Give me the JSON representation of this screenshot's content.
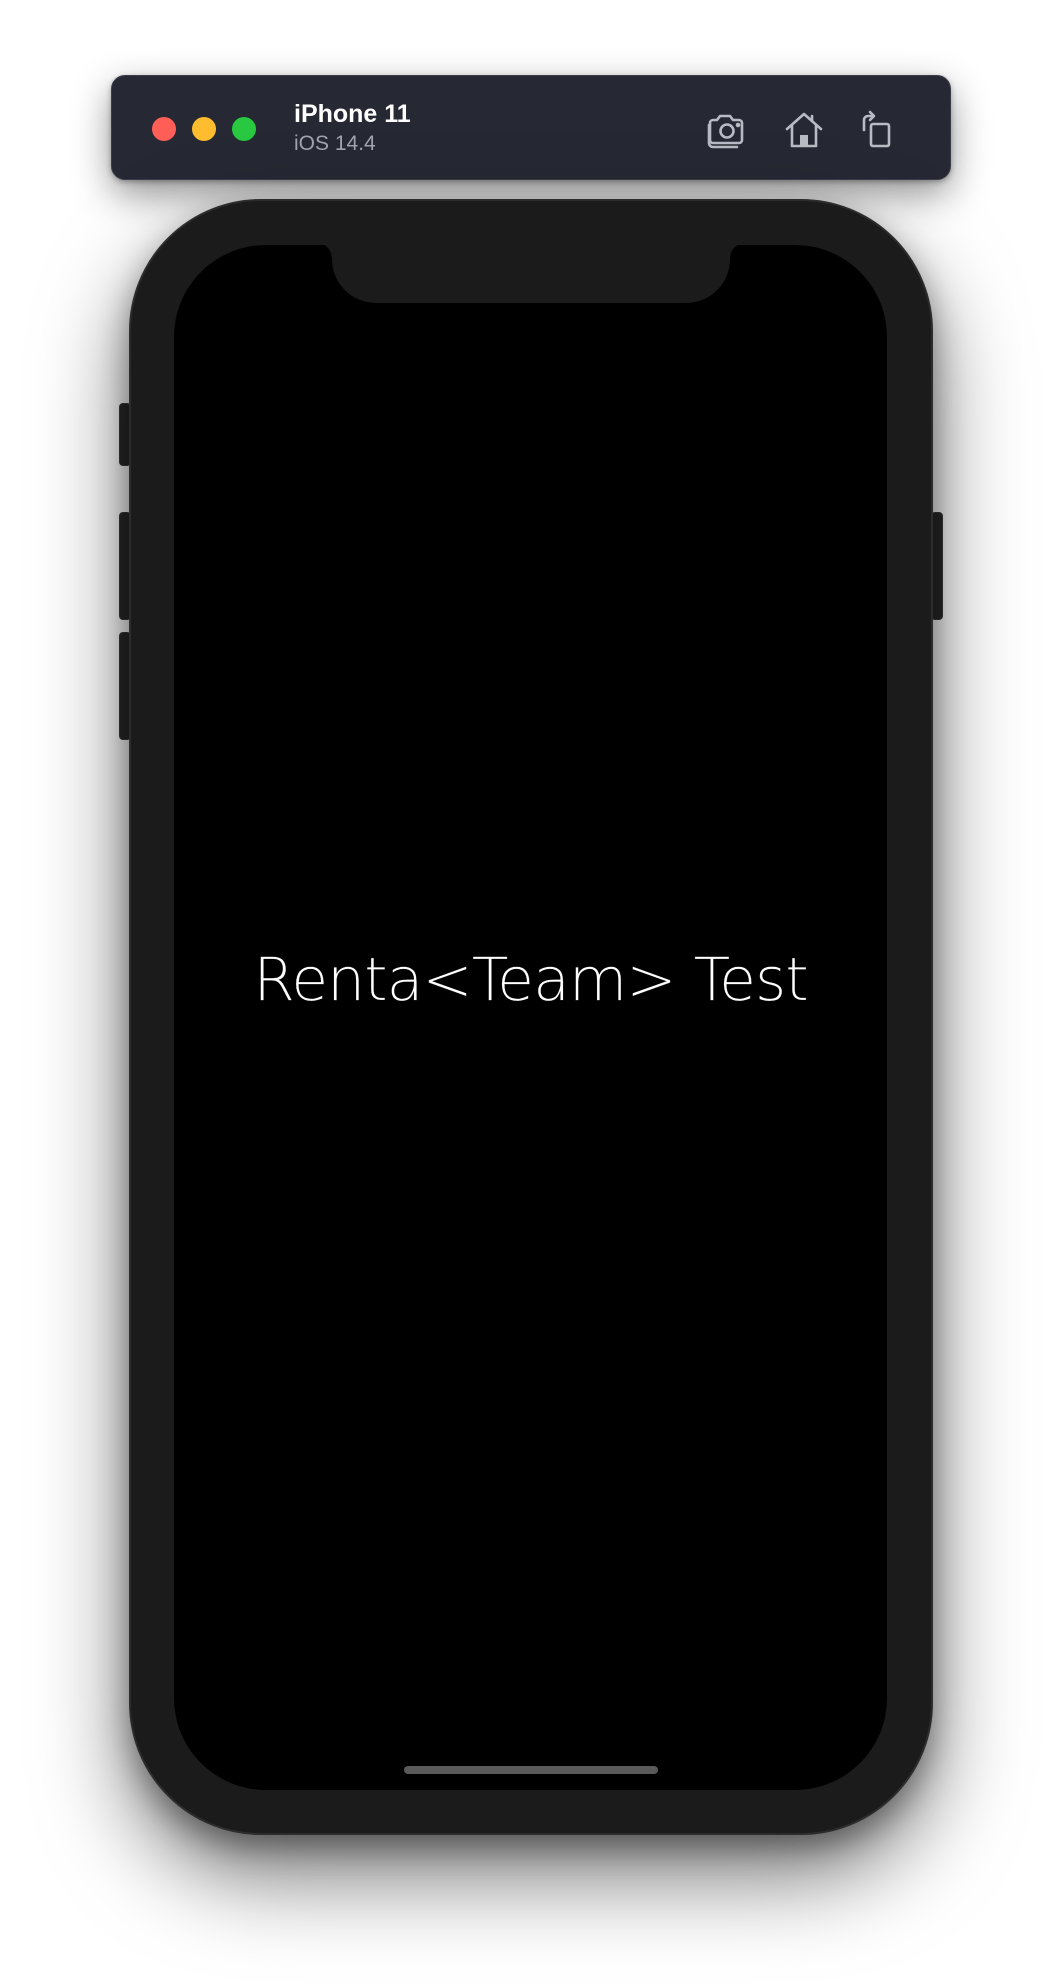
{
  "window": {
    "device_name": "iPhone 11",
    "os_version": "iOS 14.4",
    "traffic_lights": {
      "close_color": "#FF5F57",
      "minimize_color": "#FEBC2E",
      "zoom_color": "#28C840"
    },
    "toolbar": {
      "screenshot_icon": "camera-icon",
      "home_icon": "home-icon",
      "rotate_icon": "rotate-icon"
    }
  },
  "app": {
    "title": "Renta<Team> Test",
    "background_color": "#000000",
    "text_color": "#FFFFFF"
  }
}
